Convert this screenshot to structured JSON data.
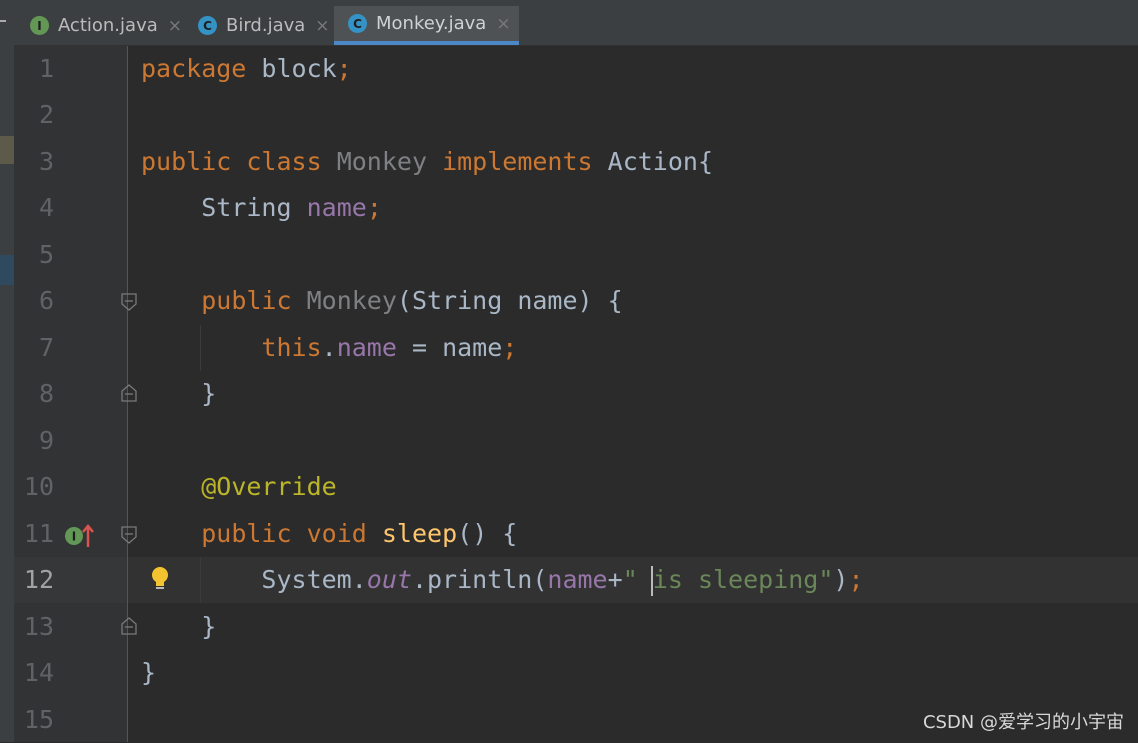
{
  "tabs": [
    {
      "label": "Action.java",
      "icon": "interface-icon",
      "icon_letter": "I",
      "active": false
    },
    {
      "label": "Bird.java",
      "icon": "class-icon",
      "icon_letter": "C",
      "active": false
    },
    {
      "label": "Monkey.java",
      "icon": "class-icon",
      "icon_letter": "C",
      "active": true
    }
  ],
  "tab_close_glyph": "×",
  "line_numbers": [
    "1",
    "2",
    "3",
    "4",
    "5",
    "6",
    "7",
    "8",
    "9",
    "10",
    "11",
    "12",
    "13",
    "14",
    "15"
  ],
  "current_line": "12",
  "code": {
    "l1": {
      "kw": "package",
      "rest": " block",
      "semi": ";"
    },
    "l3": {
      "kw1": "public",
      "kw2": "class",
      "name": "Monkey",
      "kw3": "implements",
      "iface": "Action{"
    },
    "l4": {
      "type": "String",
      "field": "name",
      "semi": ";"
    },
    "l6": {
      "kw": "public",
      "name": "Monkey",
      "params": "(String name) {"
    },
    "l7": {
      "kw": "this",
      "dot": ".",
      "field": "name",
      "rest": " = name",
      "semi": ";"
    },
    "l8": {
      "text": "}"
    },
    "l10": {
      "ann": "@Override"
    },
    "l11": {
      "kw1": "public",
      "kw2": "void",
      "method": "sleep",
      "rest": "() {"
    },
    "l12": {
      "sys": "System.",
      "out": "out",
      "call": ".println(",
      "arg": "name",
      "plus": "+",
      "str": "\" is sleeping\"",
      "close": ")",
      "semi": ";"
    },
    "l13": {
      "text": "}"
    },
    "l14": {
      "text": "}"
    }
  },
  "colors": {
    "keyword": "#cc7832",
    "field": "#9876aa",
    "string": "#6a8759",
    "annotation": "#bbb529",
    "method": "#ffc66d",
    "text": "#a9b7c6",
    "tab_accent": "#4a88c7"
  },
  "watermark": "CSDN @爱学习的小宇宙"
}
